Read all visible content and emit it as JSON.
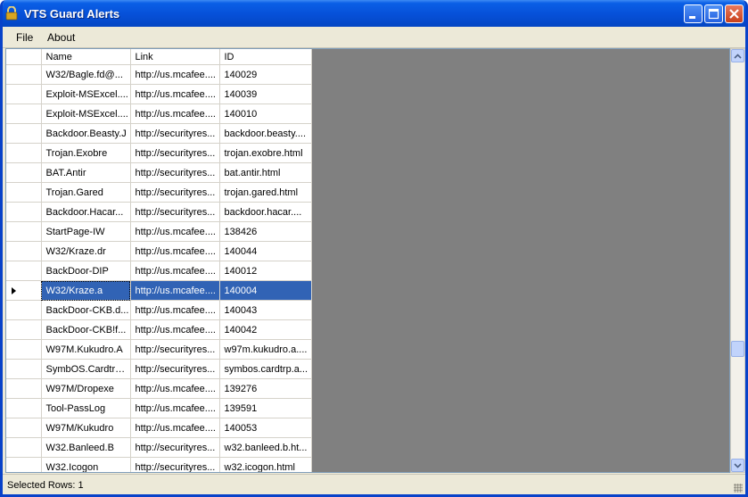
{
  "window": {
    "title": "VTS Guard Alerts"
  },
  "menu": {
    "items": [
      "File",
      "About"
    ]
  },
  "table": {
    "columns": [
      "Name",
      "Link",
      "ID"
    ],
    "selected_index": 11,
    "rows": [
      [
        "W32/Bagle.fd@...",
        "http://us.mcafee....",
        "140029"
      ],
      [
        "Exploit-MSExcel....",
        "http://us.mcafee....",
        "140039"
      ],
      [
        "Exploit-MSExcel....",
        "http://us.mcafee....",
        "140010"
      ],
      [
        "Backdoor.Beasty.J",
        "http://securityres...",
        "backdoor.beasty...."
      ],
      [
        "Trojan.Exobre",
        "http://securityres...",
        "trojan.exobre.html"
      ],
      [
        "BAT.Antir",
        "http://securityres...",
        "bat.antir.html"
      ],
      [
        "Trojan.Gared",
        "http://securityres...",
        "trojan.gared.html"
      ],
      [
        "Backdoor.Hacar...",
        "http://securityres...",
        "backdoor.hacar...."
      ],
      [
        "StartPage-IW",
        "http://us.mcafee....",
        "138426"
      ],
      [
        "W32/Kraze.dr",
        "http://us.mcafee....",
        "140044"
      ],
      [
        "BackDoor-DIP",
        "http://us.mcafee....",
        "140012"
      ],
      [
        "W32/Kraze.a",
        "http://us.mcafee....",
        "140004"
      ],
      [
        "BackDoor-CKB.d...",
        "http://us.mcafee....",
        "140043"
      ],
      [
        "BackDoor-CKB!f...",
        "http://us.mcafee....",
        "140042"
      ],
      [
        "W97M.Kukudro.A",
        "http://securityres...",
        "w97m.kukudro.a...."
      ],
      [
        "SymbOS.Cardtrp....",
        "http://securityres...",
        "symbos.cardtrp.a..."
      ],
      [
        "W97M/Dropexe",
        "http://us.mcafee....",
        "139276"
      ],
      [
        "Tool-PassLog",
        "http://us.mcafee....",
        "139591"
      ],
      [
        "W97M/Kukudro",
        "http://us.mcafee....",
        "140053"
      ],
      [
        "W32.Banleed.B",
        "http://securityres...",
        "w32.banleed.b.ht..."
      ],
      [
        "W32.Icogon",
        "http://securityres...",
        "w32.icogon.html"
      ]
    ]
  },
  "status": {
    "text": "Selected Rows: 1"
  }
}
